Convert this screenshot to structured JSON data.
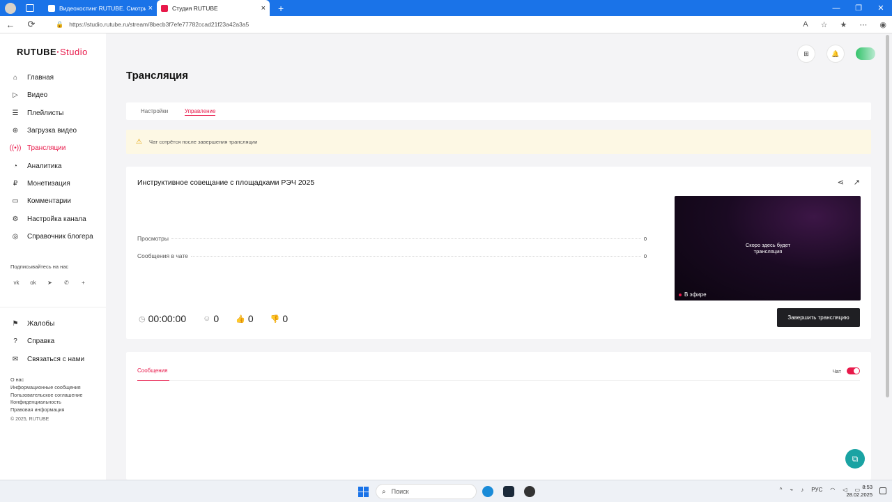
{
  "browser": {
    "tabs": [
      {
        "title": "Видеохостинг RUTUBE. Смотрите"
      },
      {
        "title": "Студия RUTUBE"
      }
    ],
    "url": "https://studio.rutube.ru/stream/8becb3f7efe77782ccad21f23a42a3a5"
  },
  "logo": {
    "brand": "RUTUBE",
    "suffix": "Studio"
  },
  "sidebar": {
    "items": [
      {
        "label": "Главная"
      },
      {
        "label": "Видео"
      },
      {
        "label": "Плейлисты"
      },
      {
        "label": "Загрузка видео"
      },
      {
        "label": "Трансляции"
      },
      {
        "label": "Аналитика"
      },
      {
        "label": "Монетизация"
      },
      {
        "label": "Комментарии"
      },
      {
        "label": "Настройка канала"
      },
      {
        "label": "Справочник блогера"
      }
    ],
    "subscribe_label": "Подписывайтесь на нас",
    "secondary": [
      {
        "label": "Жалобы"
      },
      {
        "label": "Справка"
      },
      {
        "label": "Связаться с нами"
      }
    ],
    "footer_links": [
      "О нас",
      "Информационные сообщения",
      "Пользовательское соглашение",
      "Конфиденциальность",
      "Правовая информация"
    ],
    "copyright": "© 2025, RUTUBE"
  },
  "page": {
    "title": "Трансляция",
    "tabs": [
      {
        "label": "Настройки"
      },
      {
        "label": "Управление"
      }
    ],
    "warning": "Чат сотрётся после завершения трансляции"
  },
  "stream": {
    "title": "Инструктивное совещание с площадками РЭЧ 2025",
    "stats": [
      {
        "label": "Просмотры",
        "value": "0"
      },
      {
        "label": "Сообщения в чате",
        "value": "0"
      }
    ],
    "preview_text": "Скоро здесь будет трансляция",
    "live_label": "В эфире",
    "duration": "00:00:00",
    "viewers": "0",
    "likes": "0",
    "dislikes": "0",
    "end_button": "Завершить трансляцию"
  },
  "messages": {
    "tab_label": "Сообщения",
    "chat_label": "Чат"
  },
  "taskbar": {
    "search_placeholder": "Поиск",
    "lang": "РУС",
    "time": "8:53",
    "date": "28.02.2025"
  },
  "colors": {
    "accent": "#e8194a",
    "dark_button": "#1f1f23",
    "warning_bg": "#fdf8e4"
  }
}
